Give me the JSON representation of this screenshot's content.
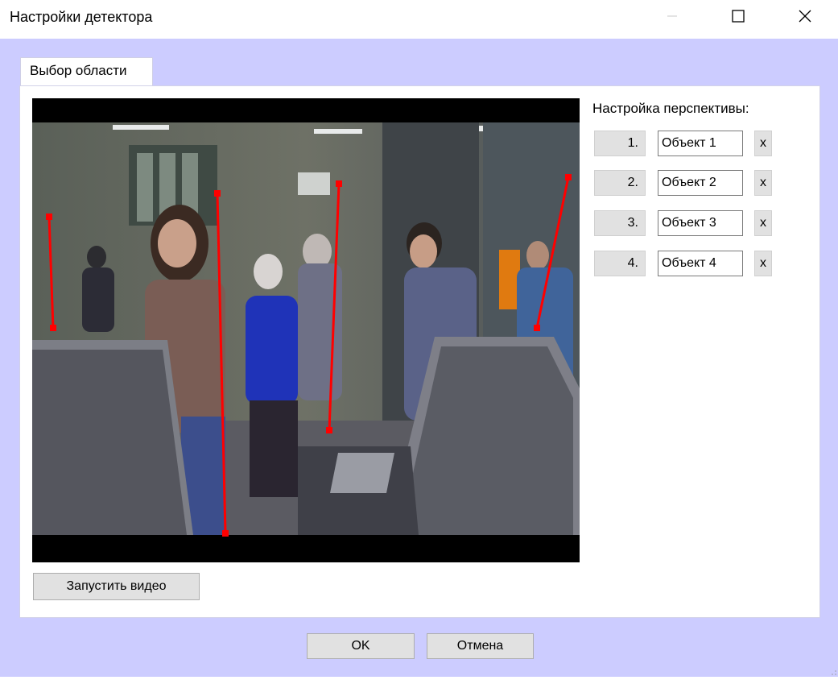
{
  "window": {
    "title": "Настройки детектора",
    "controls": [
      "minimize-icon",
      "maximize-icon",
      "close-icon"
    ]
  },
  "tab": {
    "label": "Выбор области"
  },
  "perspective": {
    "label": "Настройка перспективы:",
    "rows": [
      {
        "number": "1.",
        "name": "Объект 1",
        "delete": "x"
      },
      {
        "number": "2.",
        "name": "Объект 2",
        "delete": "x"
      },
      {
        "number": "3.",
        "name": "Объект 3",
        "delete": "x"
      },
      {
        "number": "4.",
        "name": "Объект 4",
        "delete": "x"
      }
    ]
  },
  "video": {
    "marker_color": "#ff0000",
    "frame_bar_color": "#000000"
  },
  "buttons": {
    "run_video": "Запустить видео",
    "ok": "OK",
    "cancel": "Отмена"
  },
  "colors": {
    "client_background": "#ccccff",
    "button_face": "#e1e1e1"
  }
}
